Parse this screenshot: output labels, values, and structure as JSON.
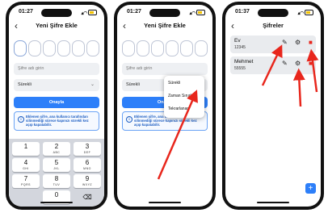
{
  "status_time": "01:27",
  "phone3_status_time": "01:37",
  "add_screen": {
    "title": "Yeni Şifre Ekle",
    "back_icon": "‹",
    "name_placeholder": "Şifre adı girin",
    "duration_value": "Sürekli",
    "confirm_label": "Onayla",
    "info_text": "Eklenen şifre, ana kullanıcı tarafından silinmediği sürece kapınızı sürekli kez açıp kapatabilir."
  },
  "keypad": [
    {
      "digit": "1",
      "letters": ""
    },
    {
      "digit": "2",
      "letters": "ABC"
    },
    {
      "digit": "3",
      "letters": "DEF"
    },
    {
      "digit": "4",
      "letters": "GHI"
    },
    {
      "digit": "5",
      "letters": "JKL"
    },
    {
      "digit": "6",
      "letters": "MNO"
    },
    {
      "digit": "7",
      "letters": "PQRS"
    },
    {
      "digit": "8",
      "letters": "TUV"
    },
    {
      "digit": "9",
      "letters": "WXYZ"
    },
    {
      "digit": "0",
      "letters": ""
    }
  ],
  "backspace_icon": "⌫",
  "dropdown_options": [
    "Sürekli",
    "Zaman Sınırlı",
    "Tekrarlanan"
  ],
  "list_screen": {
    "title": "Şifreler",
    "items": [
      {
        "name": "Ev",
        "code": "12345"
      },
      {
        "name": "Mehmet",
        "code": "55555"
      }
    ],
    "fab_icon": "+"
  },
  "colors": {
    "accent": "#2d7ff9",
    "arrow": "#e8261c",
    "delete": "#e8261c"
  },
  "icons": [
    "back-icon",
    "pencil-icon",
    "gear-icon",
    "trash-icon",
    "info-icon",
    "backspace-icon",
    "plus-icon",
    "wifi-icon",
    "battery-icon"
  ]
}
